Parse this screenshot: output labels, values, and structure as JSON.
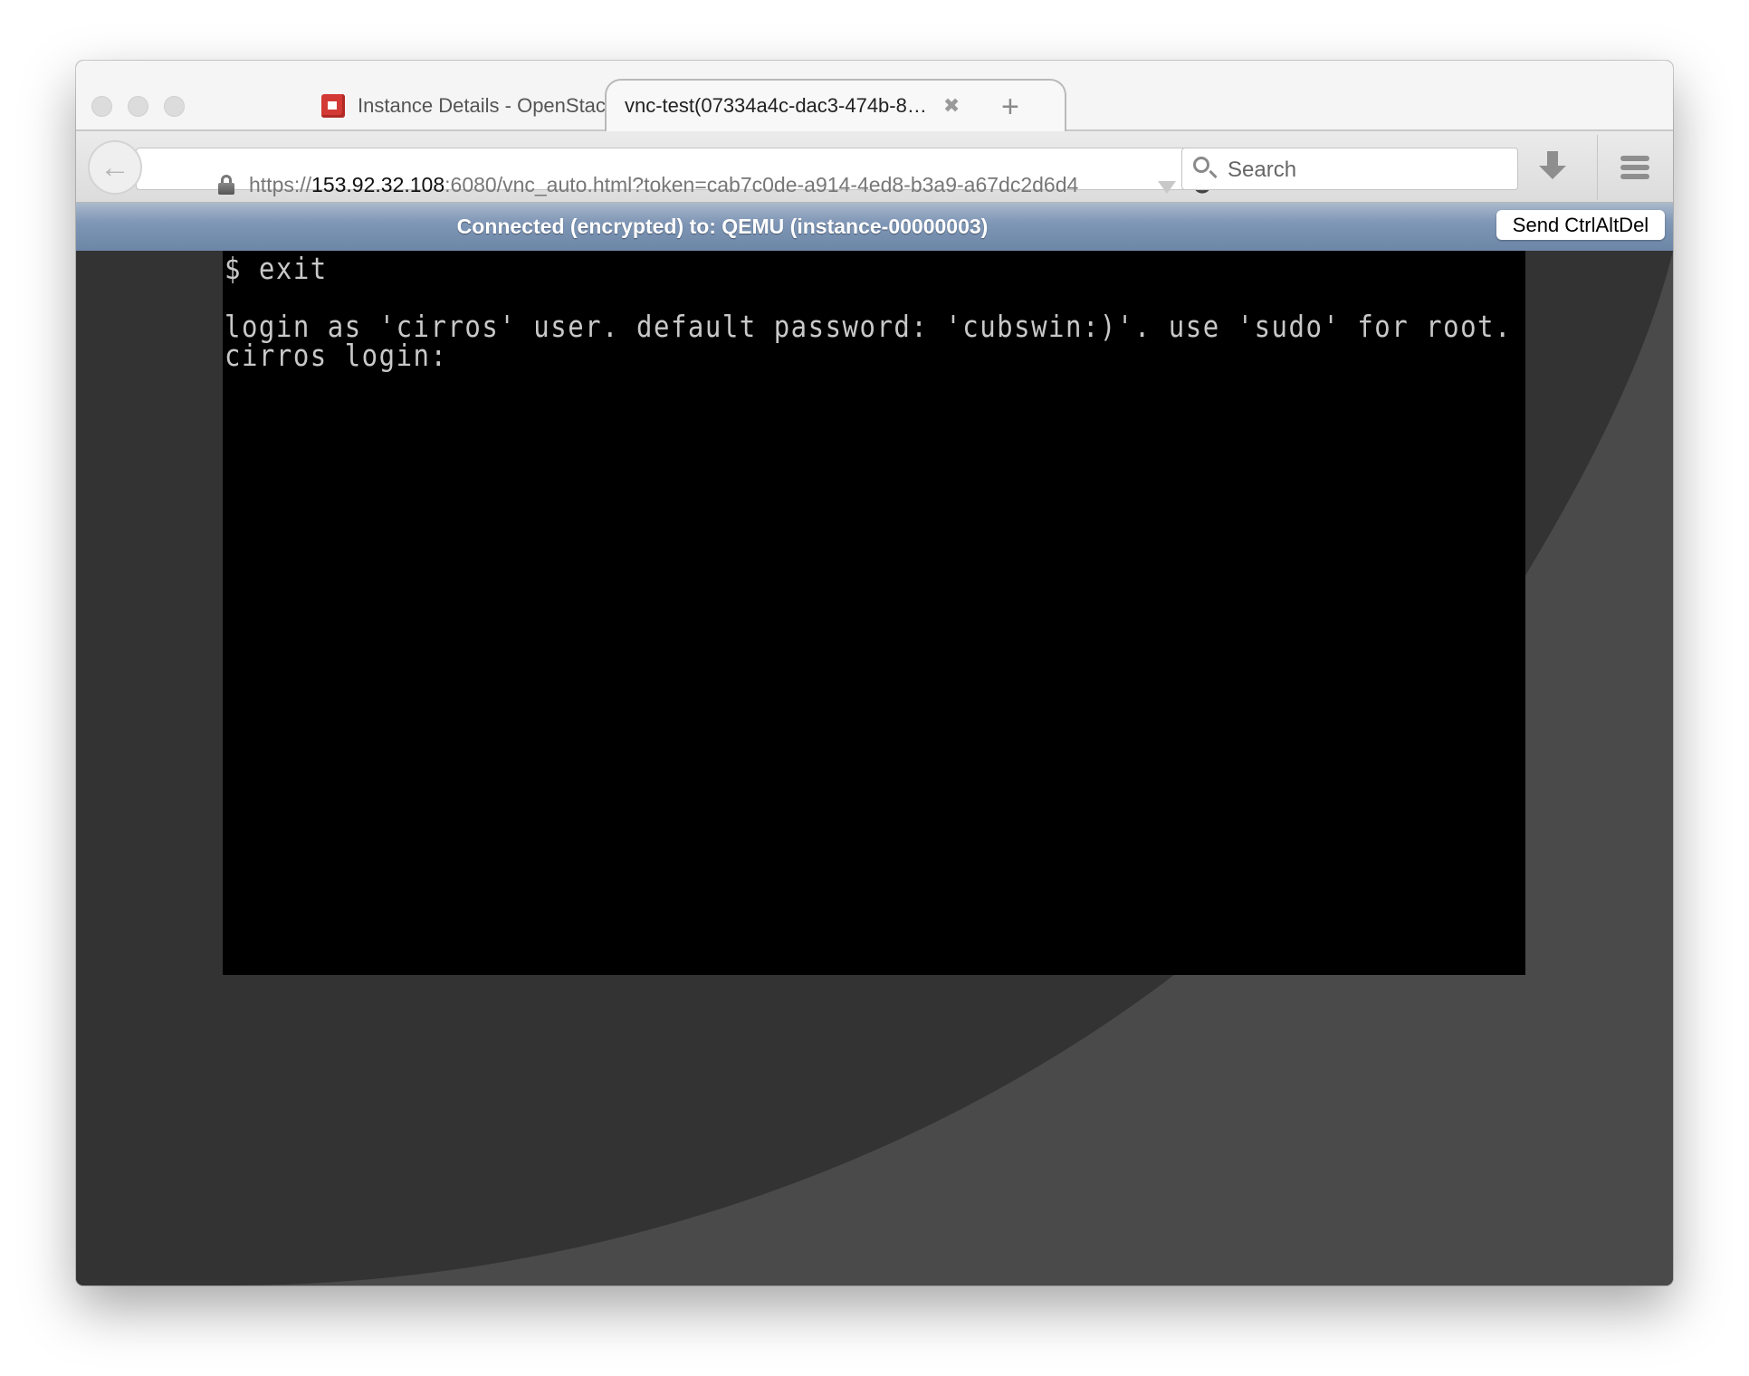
{
  "browser": {
    "window_controls": [
      "close",
      "minimize",
      "zoom"
    ],
    "tabs": [
      {
        "title": "Instance Details - OpenStac…",
        "favicon": "openstack-icon",
        "active": false,
        "close_glyph": "✖"
      },
      {
        "title": "vnc-test(07334a4c-dac3-474b-8…",
        "active": true,
        "close_glyph": "✖"
      }
    ],
    "new_tab_glyph": "+",
    "back_glyph": "←",
    "url": {
      "scheme": "https://",
      "host": "153.92.32.108",
      "rest": ":6080/vnc_auto.html?token=cab7c0de-a914-4ed8-b3a9-a67dc2d6d4"
    },
    "reload_glyph": "↻",
    "search_placeholder": "Search"
  },
  "novnc": {
    "status_text": "Connected (encrypted) to: QEMU (instance-00000003)",
    "send_cad_label": "Send CtrlAltDel",
    "colors": {
      "status_bar_top": "#aab9cd",
      "status_bar_bottom": "#6c86a7",
      "background_dark": "#333333",
      "background_light": "#4a4a4a",
      "terminal_bg": "#000000",
      "terminal_fg": "#c8c8c8"
    }
  },
  "terminal": {
    "lines": [
      "$ exit",
      "",
      "login as 'cirros' user. default password: 'cubswin:)'. use 'sudo' for root.",
      "cirros login:"
    ]
  }
}
